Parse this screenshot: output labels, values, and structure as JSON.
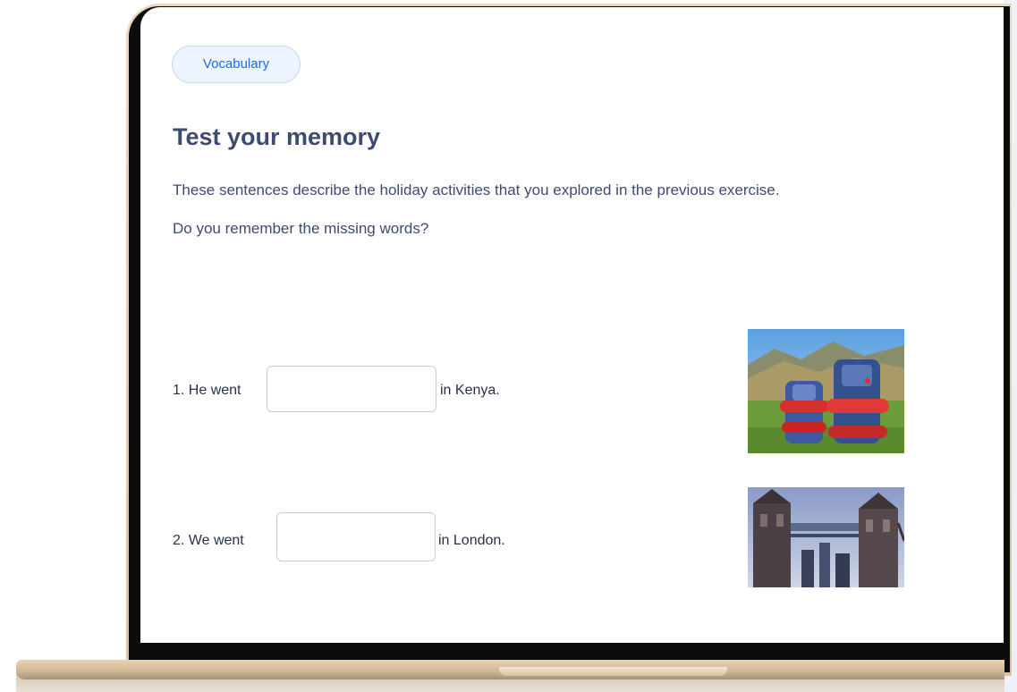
{
  "lesson": {
    "tag_label": "Vocabulary",
    "title": "Test your memory",
    "description_line1": "These sentences describe the holiday activities that you explored  in the previous exercise.",
    "description_line2": "Do you remember the missing words?"
  },
  "questions": [
    {
      "prefix": "1. He went",
      "answer_value": "",
      "suffix": "in Kenya.",
      "image": "backpacks-photo"
    },
    {
      "prefix": "2. We went",
      "answer_value": "",
      "suffix": "in London.",
      "image": "tower-bridge-photo"
    }
  ],
  "colors": {
    "accent": "#1c6de0",
    "heading": "#3d4b73",
    "laptop_gold": "#e0ccab"
  }
}
